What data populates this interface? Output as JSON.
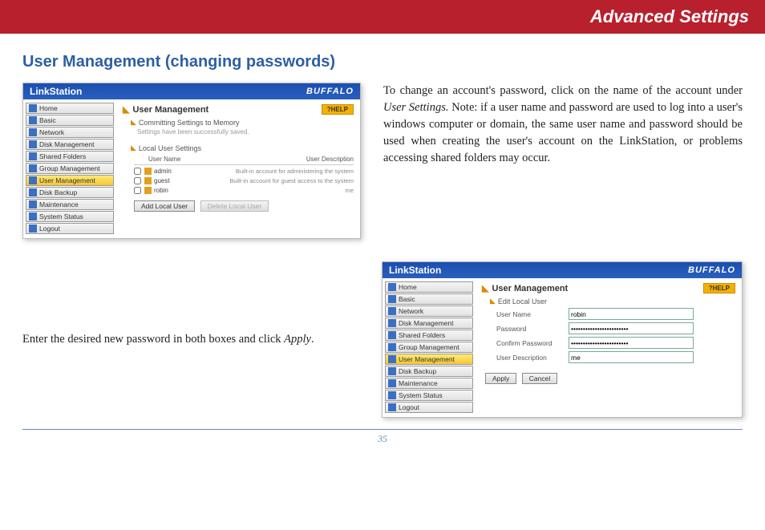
{
  "header": {
    "title": "Advanced Settings"
  },
  "section": {
    "title": "User Management (changing passwords)"
  },
  "para1_a": "To change an account's password, click on the name of the account under ",
  "para1_em": "User Settings.",
  "para1_b": "  Note: if a user name and password are used to log into a user's windows computer or domain, the same user name and password should be used when creating the user's account on the LinkStation, or problems accessing shared folders may occur.",
  "para2_a": "Enter the desired new password in both boxes and click ",
  "para2_em": "Apply",
  "para2_b": ".",
  "page_number": "35",
  "shot": {
    "brand": "LinkStation",
    "logo": "BUFFALO",
    "help": "?HELP",
    "nav": [
      "Home",
      "Basic",
      "Network",
      "Disk Management",
      "Shared Folders",
      "Group Management",
      "User Management",
      "Disk Backup",
      "Maintenance",
      "System Status",
      "Logout"
    ],
    "nav_selected_index": 6
  },
  "shot1": {
    "title": "User Management",
    "sub1": "Committing Settings to Memory",
    "sub1_msg": "Settings have been successfully saved.",
    "sub2": "Local User Settings",
    "col_user": "User Name",
    "col_desc": "User Description",
    "users": [
      {
        "name": "admin",
        "desc": "Built-in account for administering the system"
      },
      {
        "name": "guest",
        "desc": "Built-in account for guest access to the system"
      },
      {
        "name": "robin",
        "desc": "me"
      }
    ],
    "btn_add": "Add Local User",
    "btn_del": "Delete Local User"
  },
  "shot2": {
    "title": "User Management",
    "sub": "Edit Local User",
    "fields": {
      "username_lbl": "User Name",
      "username_val": "robin",
      "password_lbl": "Password",
      "password_val": "••••••••••••••••••••••••",
      "confirm_lbl": "Confirm Password",
      "confirm_val": "••••••••••••••••••••••••",
      "desc_lbl": "User Description",
      "desc_val": "me"
    },
    "btn_apply": "Apply",
    "btn_cancel": "Cancel"
  }
}
